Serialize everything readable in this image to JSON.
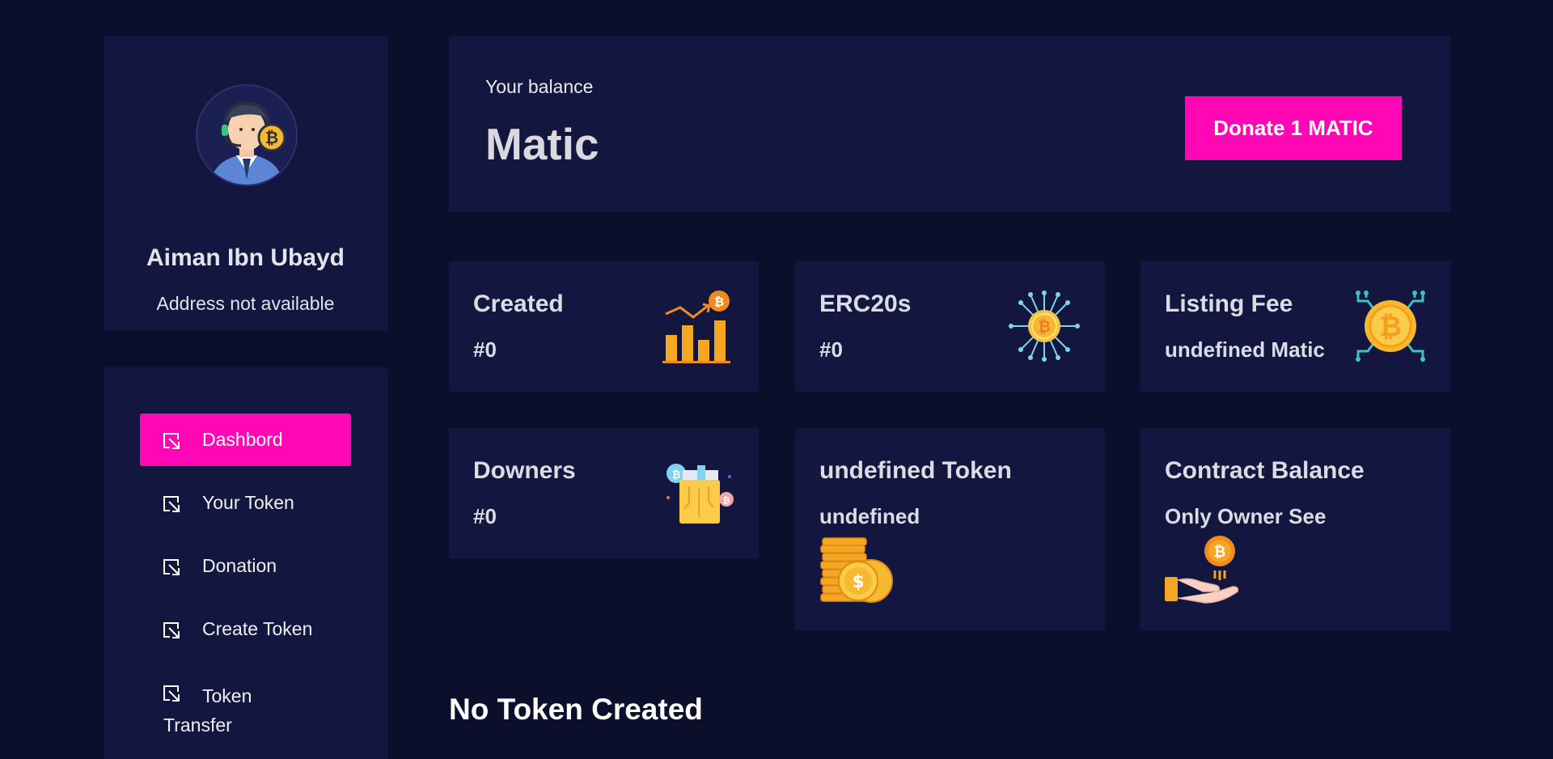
{
  "profile": {
    "name": "Aiman Ibn Ubayd",
    "address": "Address not available"
  },
  "nav": {
    "items": [
      {
        "label": "Dashbord",
        "active": true
      },
      {
        "label": "Your Token"
      },
      {
        "label": "Donation"
      },
      {
        "label": "Create Token"
      },
      {
        "label": "Token Transfer"
      }
    ]
  },
  "balance": {
    "label": "Your balance",
    "value": "Matic",
    "donate_label": "Donate 1 MATIC"
  },
  "stats": {
    "created": {
      "title": "Created",
      "value": "#0",
      "icon": "bar-chart-bitcoin-icon"
    },
    "erc20s": {
      "title": "ERC20s",
      "value": "#0",
      "icon": "bitcoin-network-icon"
    },
    "listing_fee": {
      "title": "Listing Fee",
      "value": "undefined Matic",
      "icon": "bitcoin-circuit-icon"
    },
    "downers": {
      "title": "Downers",
      "value": "#0",
      "icon": "crypto-wallet-icon"
    },
    "token": {
      "title": "undefined Token",
      "value": "undefined",
      "icon": "coin-stack-icon"
    },
    "contract_balance": {
      "title": "Contract Balance",
      "value": "Only Owner See",
      "icon": "hand-coin-icon"
    }
  },
  "empty_state": "No Token Created",
  "colors": {
    "background": "#0c0f2c",
    "panel": "#13163e",
    "accent": "#ff07b4"
  }
}
